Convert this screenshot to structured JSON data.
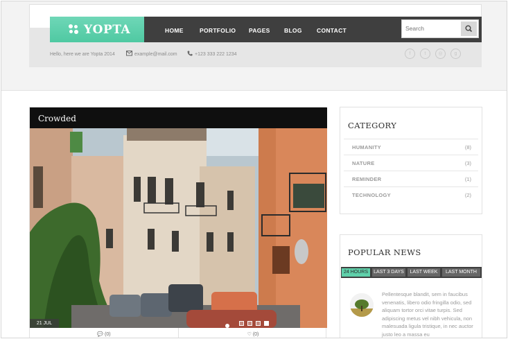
{
  "brand": {
    "logo_text": "YOPTA",
    "accent": "#5fd0aa"
  },
  "nav": {
    "items": [
      {
        "label": "HOME"
      },
      {
        "label": "PORTFOLIO"
      },
      {
        "label": "PAGES"
      },
      {
        "label": "BLOG"
      },
      {
        "label": "CONTACT"
      }
    ]
  },
  "search": {
    "placeholder": "Search"
  },
  "info_bar": {
    "greeting": "Hello, here we are Yopta 2014",
    "email": "example@mail.com",
    "phone": "+123 333 222 1234",
    "social": [
      {
        "icon": "facebook-icon",
        "glyph": "f"
      },
      {
        "icon": "twitter-icon",
        "glyph": "t"
      },
      {
        "icon": "dribbble-icon",
        "glyph": "◎"
      },
      {
        "icon": "google-plus-icon",
        "glyph": "g"
      }
    ]
  },
  "post": {
    "title": "Crowded",
    "date": "21 JUL",
    "comments": "(0)",
    "likes": "(0)",
    "slider_dots": 4,
    "active_dot": 3
  },
  "category_widget": {
    "title": "CATEGORY",
    "items": [
      {
        "name": "HUMANITY",
        "count": "(8)"
      },
      {
        "name": "NATURE",
        "count": "(3)"
      },
      {
        "name": "REMINDER",
        "count": "(1)"
      },
      {
        "name": "TECHNOLOGY",
        "count": "(2)"
      }
    ]
  },
  "popular_news": {
    "title": "POPULAR NEWS",
    "tabs": [
      {
        "label": "24 HOURS",
        "active": true
      },
      {
        "label": "LAST 3 DAYS",
        "active": false
      },
      {
        "label": "LAST WEEK",
        "active": false
      },
      {
        "label": "LAST MONTH",
        "active": false
      }
    ],
    "item_text": "Pellentesque blandit, sem in faucibus venenatis, libero odio fringilla odio, sed aliquam tortor orci vitae turpis. Sed adipiscing metus vel nibh vehicula, non malesuada ligula tristique, in nec auctor justo leo a massa eu"
  }
}
